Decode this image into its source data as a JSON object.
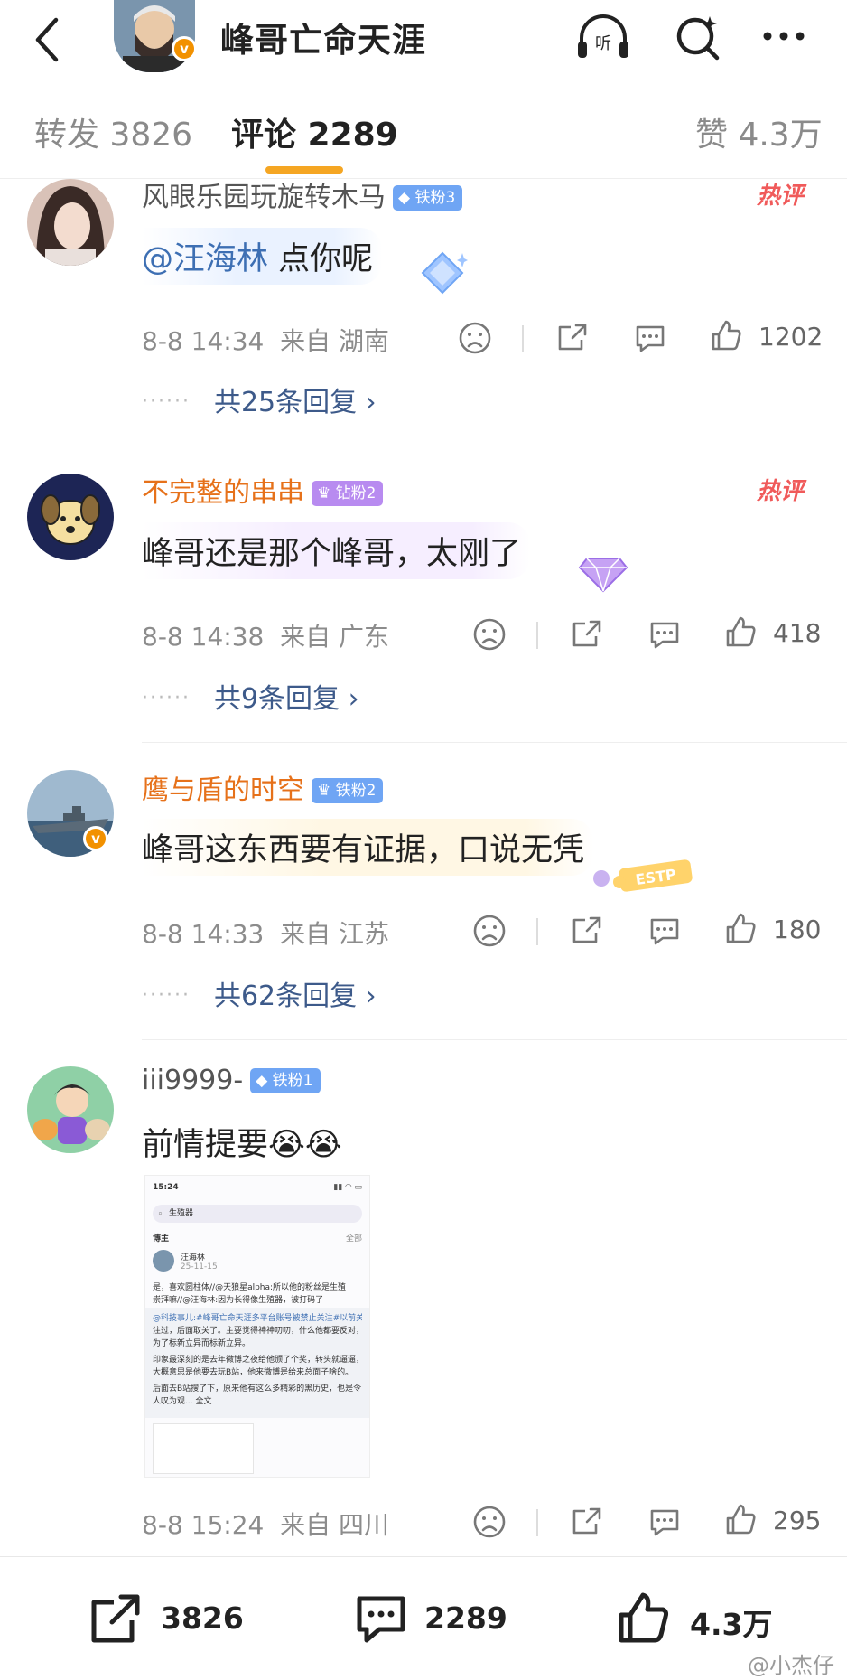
{
  "header": {
    "title": "峰哥亡命天涯"
  },
  "tabs": [
    {
      "label": "转发 3826"
    },
    {
      "label": "评论 2289"
    },
    {
      "label": "赞 4.3万"
    }
  ],
  "comments": [
    {
      "name": "风眼乐园玩旋转木马",
      "badge": "铁粉3",
      "hot": "热评",
      "mention": "@汪海林",
      "text": " 点你呢",
      "time": "8-8 14:34",
      "from": "来自 湖南",
      "likes": "1202",
      "replies": "共25条回复 ›"
    },
    {
      "name": "不完整的串串",
      "badge": "钻粉2",
      "hot": "热评",
      "text": "峰哥还是那个峰哥，太刚了",
      "time": "8-8 14:38",
      "from": "来自 广东",
      "likes": "418",
      "replies": "共9条回复 ›"
    },
    {
      "name": "鹰与盾的时空",
      "badge": "铁粉2",
      "text": "峰哥这东西要有证据，口说无凭",
      "time": "8-8 14:33",
      "from": "来自 江苏",
      "likes": "180",
      "replies": "共62条回复 ›"
    },
    {
      "name": "iii9999-",
      "badge": "铁粉1",
      "text": "前情提要",
      "emoji": "😭😭",
      "time": "8-8 15:24",
      "from": "来自 四川",
      "likes": "295"
    }
  ],
  "embedded_screenshot": {
    "time": "15:24",
    "search": "生殖器",
    "section": "博主",
    "all": "全部",
    "author": "汪海林",
    "date": "25-11-15",
    "lines": [
      "是，喜欢圆柱体//@天狼星alpha:所以他的粉丝是生殖",
      "崇拜嘛//@汪海林:因为长得像生殖器，被打码了",
      "@科技事儿:#峰哥亡命天涯多平台账号被禁止关注#以前关",
      "注过，后面取关了。主要觉得神神叨叨，什么他都要反对，",
      "为了标新立异而标新立异。",
      "印象最深刻的是去年微博之夜给他颁了个奖，转头就逼逼，",
      "大概意思是他要去玩B站，他来微博是给来总面子啥的。",
      "后面去B站搜了下，原来他有这么多精彩的黑历史，也是令",
      "人叹为观... 全文"
    ]
  },
  "bottom": {
    "repost": "3826",
    "comment": "2289",
    "like": "4.3万"
  },
  "watermark": "@小杰仔",
  "colors": {
    "accent": "#f5a623",
    "link": "#3d6fb3",
    "orange_name": "#e6711a",
    "hot": "#f05a5a"
  }
}
